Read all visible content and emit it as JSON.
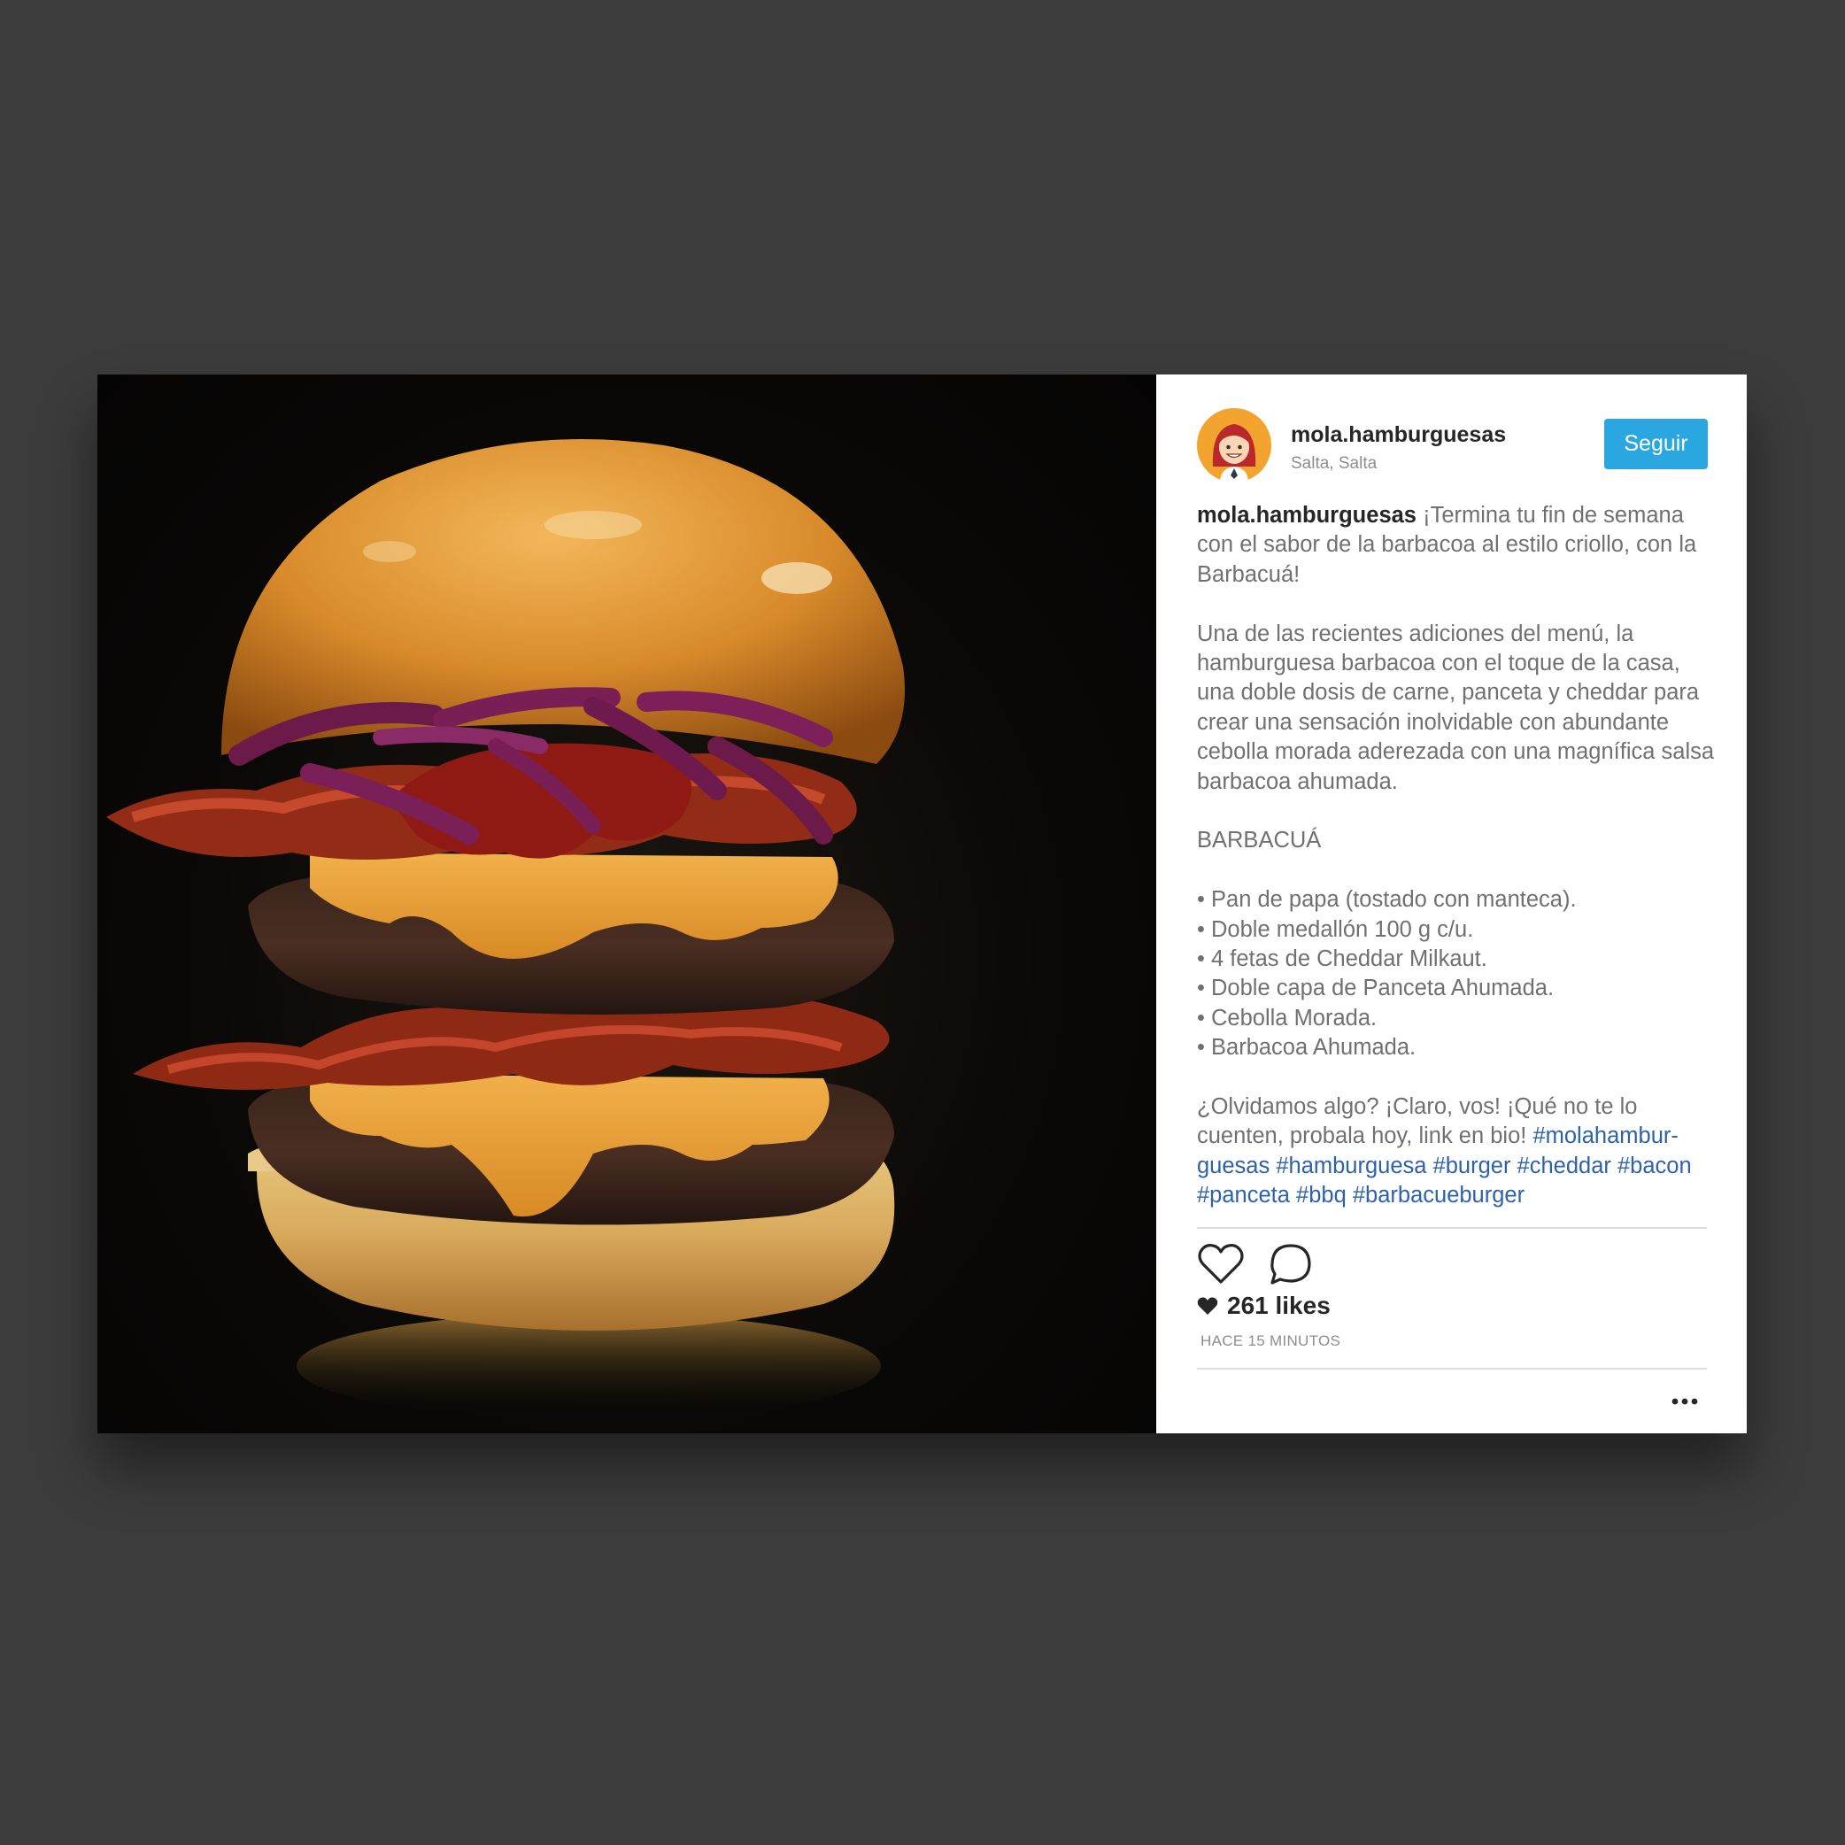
{
  "post": {
    "username": "mola.hamburguesas",
    "location": "Salta, Salta",
    "follow_label": "Seguir",
    "caption": {
      "username": "mola.hamburguesas",
      "intro": "¡Termina tu fin de semana con el sabor de la barbacoa al estilo criollo, con la Barbacuá!",
      "body": "Una de las recientes adiciones del menú, la hamburguesa barbacoa con el toque de la casa, una doble dosis de carne, panceta y cheddar para crear una sensación inolvidable con abundante cebolla morada aderezada con una magnífica salsa barbacoa ahumada.",
      "heading": "BARBACUÁ",
      "ingredients": [
        "• Pan de papa (tostado con manteca).",
        "• Doble medallón 100 g c/u.",
        "• 4 fetas de Cheddar Milkaut.",
        "• Doble capa de Panceta Ahumada.",
        "• Cebolla Morada.",
        "• Barbacoa Ahumada."
      ],
      "closing": "¿Olvidamos algo? ¡Claro, vos! ¡Qué no te lo cuenten, probala hoy, link en bio! ",
      "hashtags": [
        "#molahambur-guesas",
        "#hamburguesa",
        "#burger",
        "#cheddar",
        "#bacon",
        "#panceta",
        "#bbq",
        "#barbacueburger"
      ]
    },
    "likes_text": "261 likes",
    "timestamp": "HACE 15 MINUTOS",
    "icons": {
      "like": "heart-outline-icon",
      "comment": "comment-bubble-icon",
      "likes": "heart-filled-icon",
      "more": "more-dots-icon"
    },
    "colors": {
      "follow": "#2aa7e0",
      "hashtag": "#2d62a8",
      "background": "#3c3c3c"
    }
  }
}
